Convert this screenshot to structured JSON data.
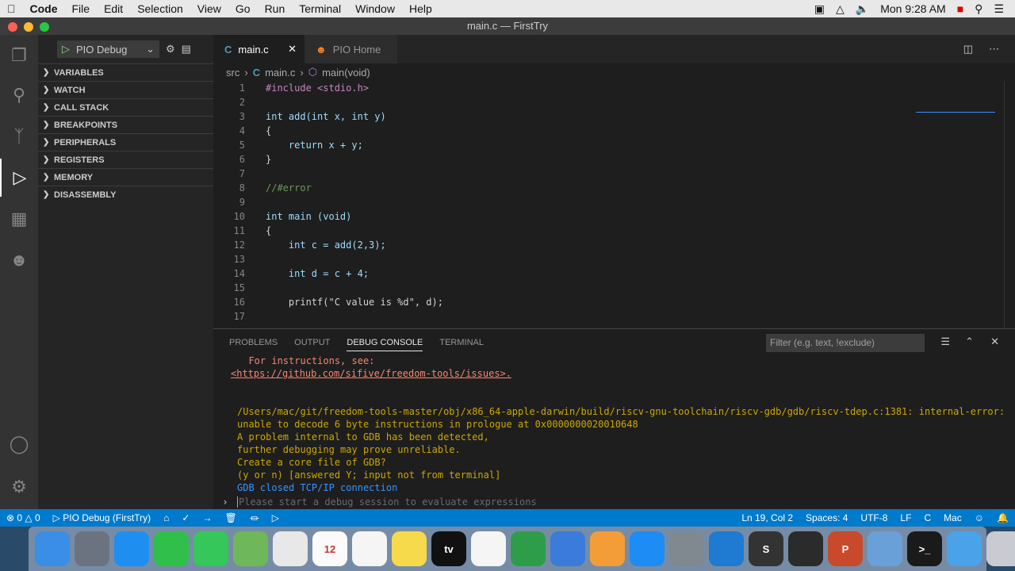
{
  "menubar": {
    "items": [
      "Code",
      "File",
      "Edit",
      "Selection",
      "View",
      "Go",
      "Run",
      "Terminal",
      "Window",
      "Help"
    ],
    "clock": "Mon 9:28 AM"
  },
  "window": {
    "title": "main.c — FirstTry"
  },
  "debug": {
    "config": "PIO Debug",
    "sections": [
      "VARIABLES",
      "WATCH",
      "CALL STACK",
      "BREAKPOINTS",
      "PERIPHERALS",
      "REGISTERS",
      "MEMORY",
      "DISASSEMBLY"
    ]
  },
  "tabs": [
    {
      "label": "main.c",
      "icon": "C"
    },
    {
      "label": "PIO Home",
      "icon": "pio-icon"
    }
  ],
  "breadcrumb": {
    "folder": "src",
    "file": "main.c",
    "symbol": "main(void)"
  },
  "code": [
    {
      "n": "1",
      "t": "#include <stdio.h>"
    },
    {
      "n": "2",
      "t": ""
    },
    {
      "n": "3",
      "t": "int add(int x, int y)"
    },
    {
      "n": "4",
      "t": "{"
    },
    {
      "n": "5",
      "t": "    return x + y;"
    },
    {
      "n": "6",
      "t": "}"
    },
    {
      "n": "7",
      "t": ""
    },
    {
      "n": "8",
      "t": "//#error"
    },
    {
      "n": "9",
      "t": ""
    },
    {
      "n": "10",
      "t": "int main (void)"
    },
    {
      "n": "11",
      "t": "{"
    },
    {
      "n": "12",
      "t": "    int c = add(2,3);"
    },
    {
      "n": "13",
      "t": ""
    },
    {
      "n": "14",
      "t": "    int d = c + 4;"
    },
    {
      "n": "15",
      "t": ""
    },
    {
      "n": "16",
      "t": "    printf(\"C value is %d\", d);"
    },
    {
      "n": "17",
      "t": ""
    }
  ],
  "panel": {
    "tabs": [
      "PROBLEMS",
      "OUTPUT",
      "DEBUG CONSOLE",
      "TERMINAL"
    ],
    "active": "DEBUG CONSOLE",
    "filter_placeholder": "Filter (e.g. text, !exclude)",
    "console": [
      {
        "t": "  For instructions, see:",
        "c": "#f48771"
      },
      {
        "t": "<https://github.com/sifive/freedom-tools/issues>.",
        "c": "#f48771"
      },
      {
        "t": "",
        "c": "#ccc"
      },
      {
        "t": "",
        "c": "#ccc"
      },
      {
        "t": "/Users/mac/git/freedom-tools-master/obj/x86_64-apple-darwin/build/riscv-gnu-toolchain/riscv-gdb/gdb/riscv-tdep.c:1381: internal-error:",
        "c": "#cca700"
      },
      {
        "t": "unable to decode 6 byte instructions in prologue at 0x0000000020010648",
        "c": "#cca700"
      },
      {
        "t": "A problem internal to GDB has been detected,",
        "c": "#cca700"
      },
      {
        "t": "further debugging may prove unreliable.",
        "c": "#cca700"
      },
      {
        "t": "Create a core file of GDB?",
        "c": "#cca700"
      },
      {
        "t": "(y or n) [answered Y; input not from terminal]",
        "c": "#cca700"
      },
      {
        "t": "GDB closed TCP/IP connection",
        "c": "#3794ff"
      }
    ],
    "repl_placeholder": "Please start a debug session to evaluate expressions"
  },
  "status": {
    "errors": "0",
    "warnings": "0",
    "debug": "PIO Debug (FirstTry)",
    "position": "Ln 19, Col 2",
    "spaces": "Spaces: 4",
    "encoding": "UTF-8",
    "eol": "LF",
    "language": "C",
    "platform": "Mac"
  },
  "dock": [
    {
      "name": "finder",
      "color": "#3a8ee6"
    },
    {
      "name": "launchpad",
      "color": "#6b7380"
    },
    {
      "name": "safari",
      "color": "#1e8ef0"
    },
    {
      "name": "facetime",
      "color": "#2fbf4a"
    },
    {
      "name": "messages",
      "color": "#35c759"
    },
    {
      "name": "maps",
      "color": "#6fb85a"
    },
    {
      "name": "photos",
      "color": "#e8e8e8"
    },
    {
      "name": "calendar",
      "color": "#fafafa",
      "label": "12"
    },
    {
      "name": "reminders",
      "color": "#f5f5f5"
    },
    {
      "name": "notes",
      "color": "#f7d94c"
    },
    {
      "name": "tv",
      "color": "#111111",
      "label": "tv"
    },
    {
      "name": "news",
      "color": "#f5f5f5"
    },
    {
      "name": "numbers",
      "color": "#2e9d4a"
    },
    {
      "name": "keynote",
      "color": "#3b7bd9"
    },
    {
      "name": "pages",
      "color": "#f29d38"
    },
    {
      "name": "app-store",
      "color": "#1d8cf5"
    },
    {
      "name": "system-preferences",
      "color": "#808890"
    },
    {
      "name": "vscode",
      "color": "#1f7ad1"
    },
    {
      "name": "sublime",
      "color": "#333333",
      "label": "S"
    },
    {
      "name": "quicktime",
      "color": "#2b2b2b"
    },
    {
      "name": "powerpoint",
      "color": "#c94a2a",
      "label": "P"
    },
    {
      "name": "preview",
      "color": "#6aa0d8"
    },
    {
      "name": "terminal",
      "color": "#1a1a1a",
      "label": ">_"
    },
    {
      "name": "downloads",
      "color": "#4aa2e8"
    },
    {
      "name": "trash",
      "color": "#c8ccd2"
    }
  ]
}
